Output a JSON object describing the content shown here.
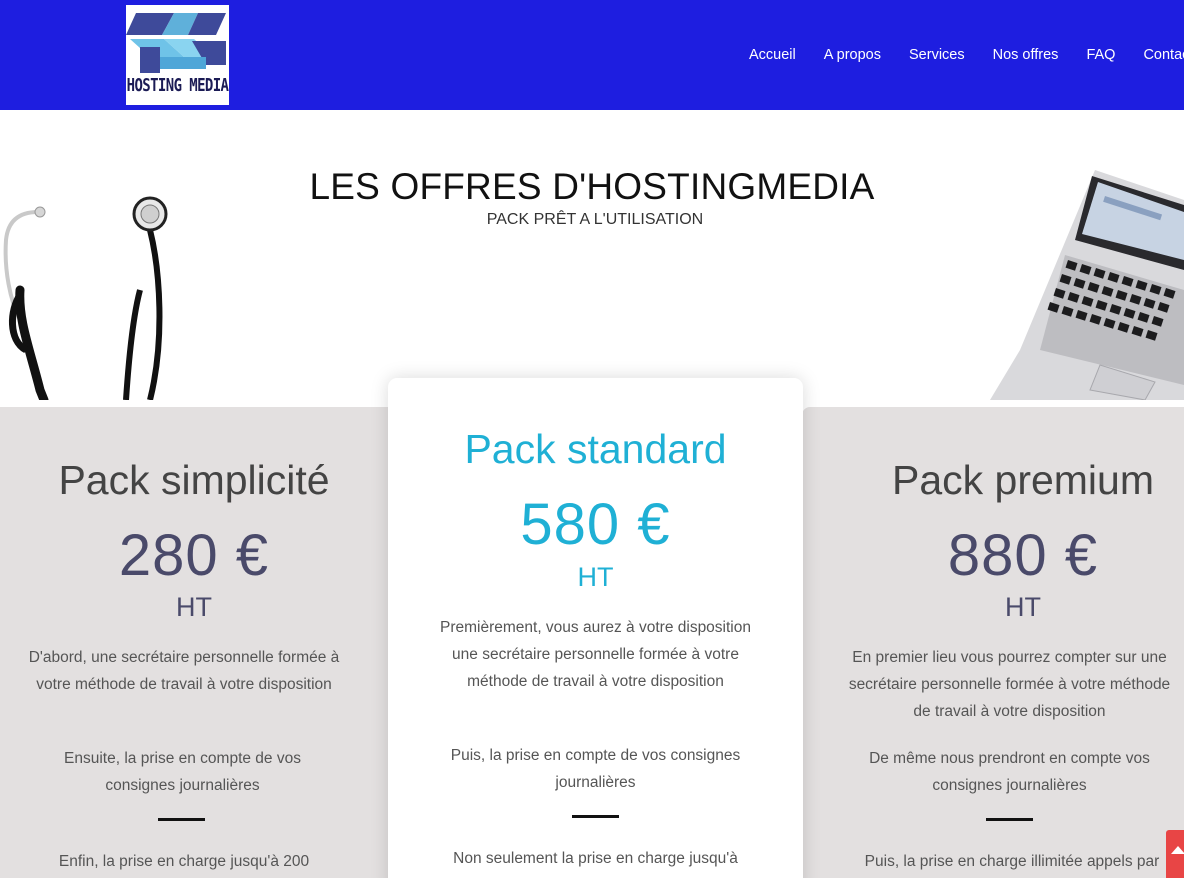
{
  "header": {
    "logo_text": "HOSTING MEDIA",
    "nav": [
      "Accueil",
      "A propos",
      "Services",
      "Nos offres",
      "FAQ",
      "Contact"
    ]
  },
  "hero": {
    "title": "LES OFFRES D'HOSTINGMEDIA",
    "subtitle": "PACK PRÊT A L'UTILISATION"
  },
  "packs": [
    {
      "name": "Pack simplicité",
      "price": "280 €",
      "ht": "HT",
      "p1": "D'abord, une secrétaire personnelle formée à votre méthode de travail à votre disposition",
      "p2": "Ensuite, la prise en compte de vos consignes journalières",
      "p3": "Enfin, la prise en charge jusqu'à  200"
    },
    {
      "name": "Pack standard",
      "price": "580 €",
      "ht": "HT",
      "p1": "Premièrement, vous aurez à votre disposition une secrétaire personnelle formée à votre méthode de travail à votre disposition",
      "p2": "Puis, la prise en compte de vos consignes journalières",
      "p3": "Non seulement la prise en charge jusqu'à"
    },
    {
      "name": "Pack premium",
      "price": "880 €",
      "ht": "HT",
      "p1": "En premier lieu vous pourrez compter sur une secrétaire personnelle formée à votre méthode de travail à votre disposition",
      "p2": "De même nous prendront en compte vos consignes journalières",
      "p3": "Puis, la prise en charge illimitée appels par"
    }
  ],
  "colors": {
    "header_bg": "#1e1ee0",
    "accent": "#1fb0d5",
    "card_bg": "#e3e0e0",
    "scroll_top": "#e84545"
  },
  "icons": [
    "stethoscope-image",
    "laptop-image",
    "arrow-up-icon"
  ]
}
